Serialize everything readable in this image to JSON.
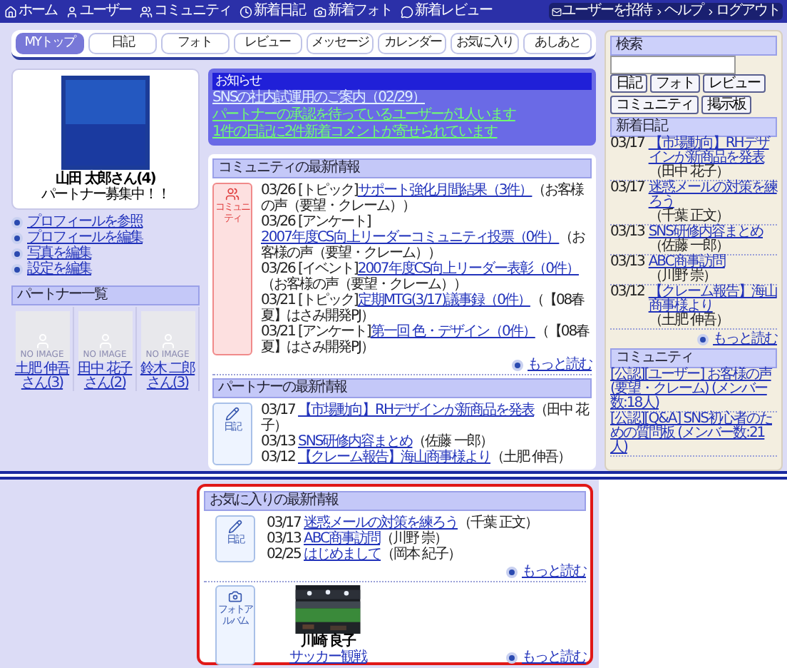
{
  "top_nav": {
    "items": [
      "ホーム",
      "ユーザー",
      "コミュニティ",
      "新着日記",
      "新着フォト",
      "新着レビュー"
    ],
    "links": [
      "ユーザーを招待",
      "ヘルプ",
      "ログアウト"
    ]
  },
  "tabs": [
    {
      "label": "MYトップ",
      "selected": true
    },
    {
      "label": "日記",
      "selected": false
    },
    {
      "label": "フォト",
      "selected": false
    },
    {
      "label": "レビュー",
      "selected": false
    },
    {
      "label": "メッセージ",
      "selected": false
    },
    {
      "label": "カレンダー",
      "selected": false
    },
    {
      "label": "お気に入り",
      "selected": false
    },
    {
      "label": "あしあと",
      "selected": false
    }
  ],
  "profile": {
    "name": "山田 太郎さん(4)",
    "status": "パートナー募集中！！",
    "links": [
      "プロフィールを参照",
      "プロフィールを編集",
      "写真を編集",
      "設定を編集"
    ]
  },
  "partners": {
    "title": "パートナー一覧",
    "items": [
      {
        "placeholder": "NO IMAGE",
        "name": "土肥 伸吾さん(3)"
      },
      {
        "placeholder": "NO IMAGE",
        "name": "田中 花子さん(2)"
      },
      {
        "placeholder": "NO IMAGE",
        "name": "鈴木 二郎さん(3)"
      }
    ]
  },
  "notice": {
    "title": "お知らせ",
    "items": [
      {
        "kind": "info",
        "text": "SNSの社内試運用のご案内（02/29）"
      },
      {
        "kind": "alert",
        "text": "パートナーの承認を待っているユーザーが1人います"
      },
      {
        "kind": "alert",
        "text": "1件の日記に2件新着コメントが寄せられています"
      }
    ]
  },
  "community_news": {
    "title": "コミュニティの最新情報",
    "icon_label": "コミュニティ",
    "more": "もっと読む",
    "items": [
      {
        "date": "03/26",
        "category": "[トピック]",
        "link": "サポート強化月間結果（3件）",
        "source": "（お客様の声（要望・クレーム））"
      },
      {
        "date": "03/26",
        "category": "[アンケート]",
        "link": "2007年度CS向上リーダーコミュニティ投票（0件）",
        "source": "（お客様の声（要望・クレーム））"
      },
      {
        "date": "03/26",
        "category": "[イベント]",
        "link": "2007年度CS向上リーダー表彰（0件）",
        "source": "（お客様の声（要望・クレーム））"
      },
      {
        "date": "03/21",
        "category": "[トピック]",
        "link": "定期MTG(3/17)議事録（0件）",
        "source": "（【08春夏】はさみ開発PJ）"
      },
      {
        "date": "03/21",
        "category": "[アンケート]",
        "link": "第一回 色・デザイン（0件）",
        "source": "（【08春夏】はさみ開発PJ）"
      }
    ]
  },
  "partner_news": {
    "title": "パートナーの最新情報",
    "icon_label": "日記",
    "items": [
      {
        "date": "03/17",
        "link": "【市場動向】RHデザインが新商品を発表",
        "author": "（田中 花子）"
      },
      {
        "date": "03/13",
        "link": "SNS研修内容まとめ",
        "author": "（佐藤 一郎）"
      },
      {
        "date": "03/12",
        "link": "【クレーム報告】海山商事様より",
        "author": "（土肥 伸吾）"
      }
    ]
  },
  "search": {
    "title": "検索",
    "buttons": [
      "日記",
      "フォト",
      "レビュー",
      "コミュニティ",
      "掲示板"
    ]
  },
  "new_diary": {
    "title": "新着日記",
    "more": "もっと読む",
    "items": [
      {
        "date": "03/17",
        "link": "【市場動向】RHデザインが新商品を発表",
        "author": "（田中 花子）"
      },
      {
        "date": "03/17",
        "link": "迷惑メールの対策を練ろう",
        "author": "（千葉 正文）"
      },
      {
        "date": "03/13",
        "link": "SNS研修内容まとめ",
        "author": "（佐藤 一郎）"
      },
      {
        "date": "03/13",
        "link": "ABC商事訪問",
        "author": "（川野 崇）"
      },
      {
        "date": "03/12",
        "link": "【クレーム報告】海山商事様より",
        "author": "（土肥 伸吾）"
      }
    ]
  },
  "communities": {
    "title": "コミュニティ",
    "items": [
      "[公認][ユーザー] お客様の声(要望・クレーム) (メンバー数:18人)",
      "[公認][Q&A] SNS初心者のための質問板 (メンバー数:21人)"
    ]
  },
  "favorites": {
    "title": "お気に入りの最新情報",
    "diary": {
      "icon_label": "日記",
      "more": "もっと読む",
      "items": [
        {
          "date": "03/17",
          "link": "迷惑メールの対策を練ろう",
          "author": "（千葉 正文）"
        },
        {
          "date": "03/13",
          "link": "ABC商事訪問",
          "author": "（川野 崇）"
        },
        {
          "date": "02/25",
          "link": "はじめまして",
          "author": "（岡本 紀子）"
        }
      ]
    },
    "photos": {
      "icon_label": "フォトアルバム",
      "more": "もっと読む",
      "items": [
        {
          "owner": "川崎 良子",
          "album": "サッカー観戦"
        }
      ]
    }
  }
}
